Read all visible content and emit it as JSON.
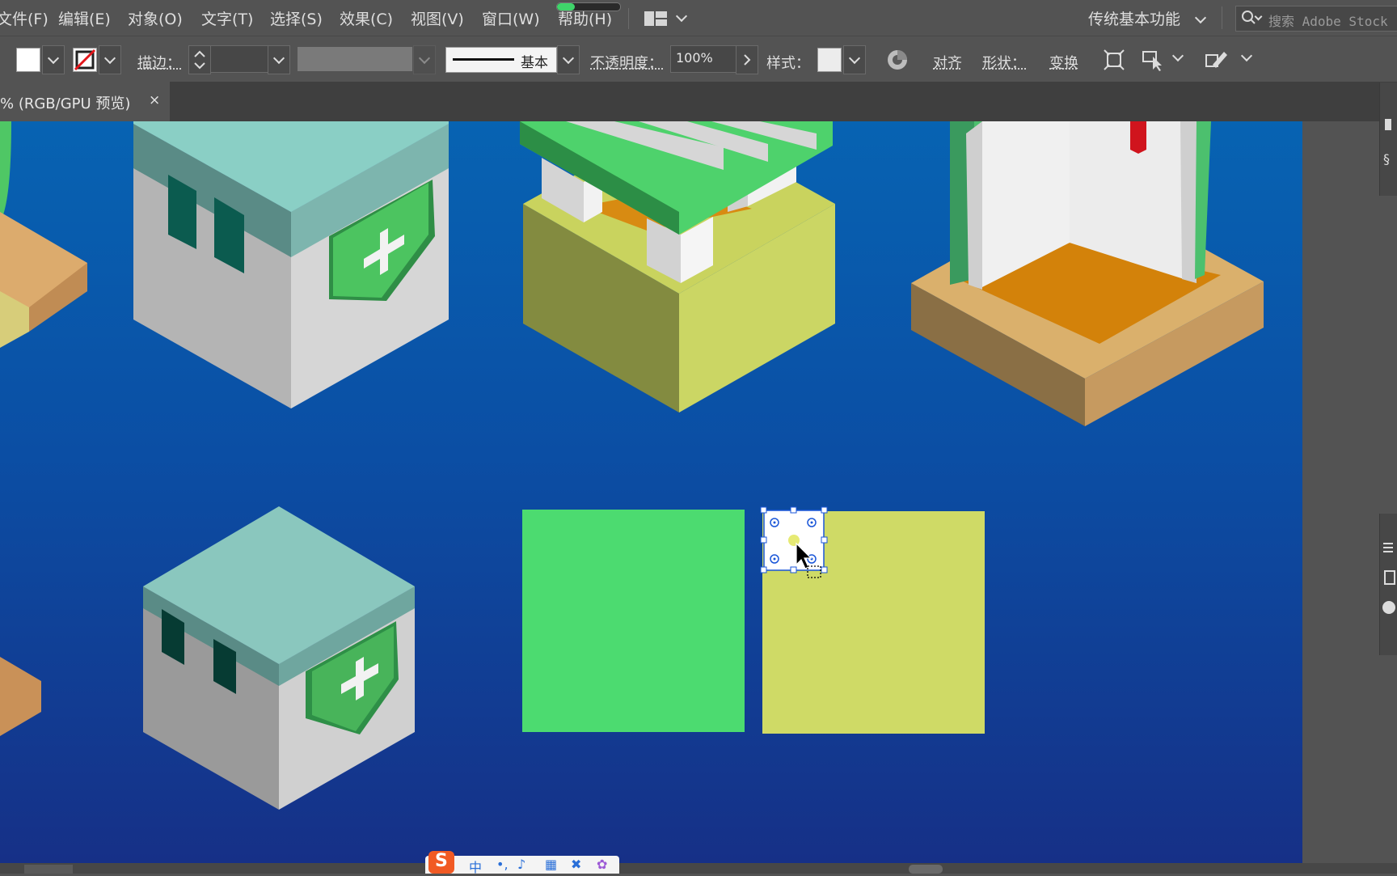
{
  "menubar": {
    "items": [
      "文件(F)",
      "编辑(E)",
      "对象(O)",
      "文字(T)",
      "选择(S)",
      "效果(C)",
      "视图(V)",
      "窗口(W)",
      "帮助(H)"
    ],
    "workspace": "传统基本功能",
    "search_placeholder": "搜索 Adobe Stock"
  },
  "controlbar": {
    "stroke_label": "描边：",
    "stroke_style": "基本",
    "opacity_label": "不透明度：",
    "opacity_value": "100%",
    "style_label": "样式：",
    "align": "对齐",
    "shape": "形状：",
    "transform": "变换"
  },
  "document": {
    "tab_label": "% (RGB/GPU 预览)",
    "close": "×"
  },
  "ime": {
    "lang": "中"
  },
  "colors": {
    "canvas_top": "#0763b2",
    "canvas_bottom": "#163087",
    "green_square": "#4cdb70",
    "yellow_square": "#cfda66",
    "selection": "#1a56d8"
  }
}
